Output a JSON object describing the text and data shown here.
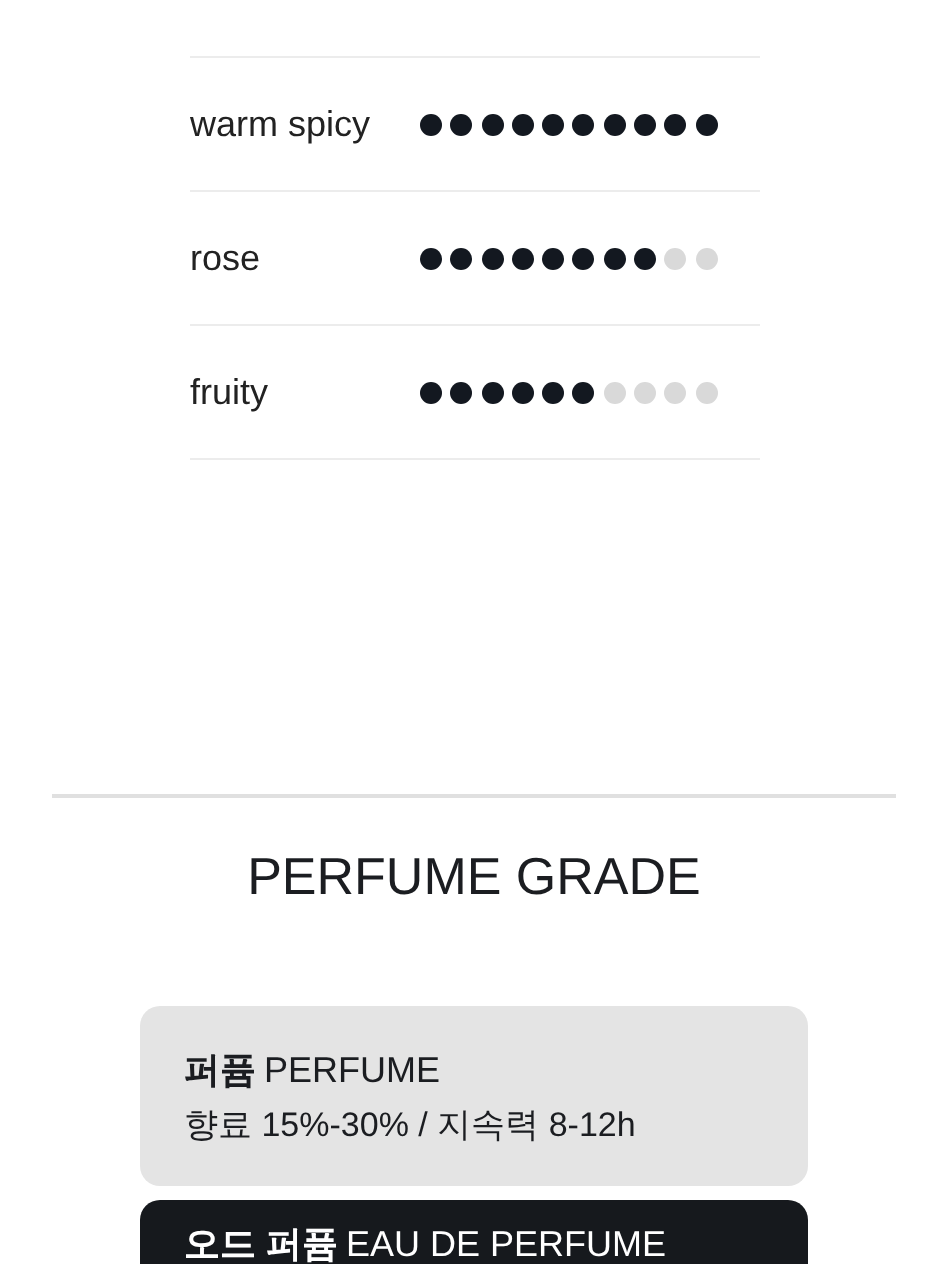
{
  "notes": [
    {
      "name": "warm spicy",
      "stars": 10
    },
    {
      "name": "rose",
      "stars": 8
    },
    {
      "name": "fruity",
      "stars": 6
    }
  ],
  "grade_title": "PERFUME GRADE",
  "grades": [
    {
      "name_ko": "퍼퓸",
      "name_en": "PERFUME",
      "detail": "향료 15%-30% / 지속력 8-12h",
      "selected": false
    },
    {
      "name_ko": "오드 퍼퓸",
      "name_en": "EAU DE PERFUME",
      "selected": true
    }
  ]
}
